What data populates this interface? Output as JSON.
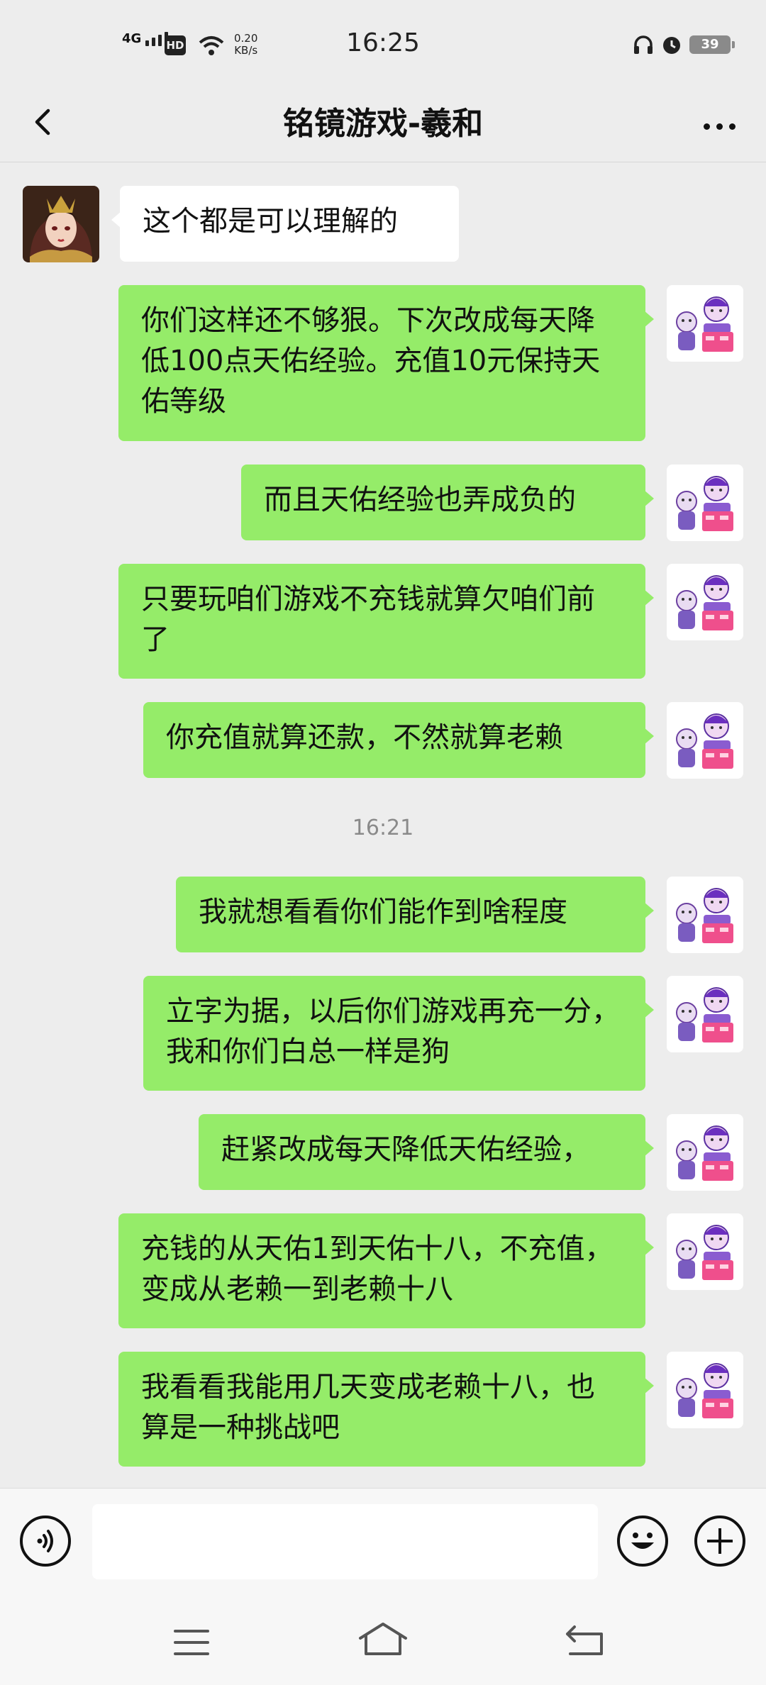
{
  "status_bar": {
    "network": "4G",
    "hd_badge": "HD",
    "speed_value": "0.20",
    "speed_unit": "KB/s",
    "time": "16:25",
    "battery": "39"
  },
  "header": {
    "title": "铭镜游戏-羲和"
  },
  "messages": [
    {
      "side": "in",
      "text": "这个都是可以理解的"
    },
    {
      "side": "out",
      "text": "你们这样还不够狠。下次改成每天降低100点天佑经验。充值10元保持天佑等级"
    },
    {
      "side": "out",
      "text": "而且天佑经验也弄成负的"
    },
    {
      "side": "out",
      "text": "只要玩咱们游戏不充钱就算欠咱们前了"
    },
    {
      "side": "out",
      "text": "你充值就算还款，不然就算老赖"
    },
    {
      "side": "out",
      "text": "我就想看看你们能作到啥程度"
    },
    {
      "side": "out",
      "text": "立字为据，以后你们游戏再充一分，我和你们白总一样是狗"
    },
    {
      "side": "out",
      "text": "赶紧改成每天降低天佑经验，"
    },
    {
      "side": "out",
      "text": "充钱的从天佑1到天佑十八，不充值，变成从老赖一到老赖十八"
    },
    {
      "side": "out",
      "text": "我看看我能用几天变成老赖十八，也算是一种挑战吧"
    }
  ],
  "timestamp": "16:21",
  "icons": {
    "back": "chevron-left-icon",
    "more": "more-dots-icon",
    "voice": "voice-icon",
    "emoji": "emoji-icon",
    "plus": "plus-icon",
    "menu": "menu-icon",
    "home": "home-icon",
    "return": "return-icon"
  },
  "colors": {
    "outgoing_bubble": "#95ec69",
    "incoming_bubble": "#ffffff",
    "background": "#ededed"
  }
}
